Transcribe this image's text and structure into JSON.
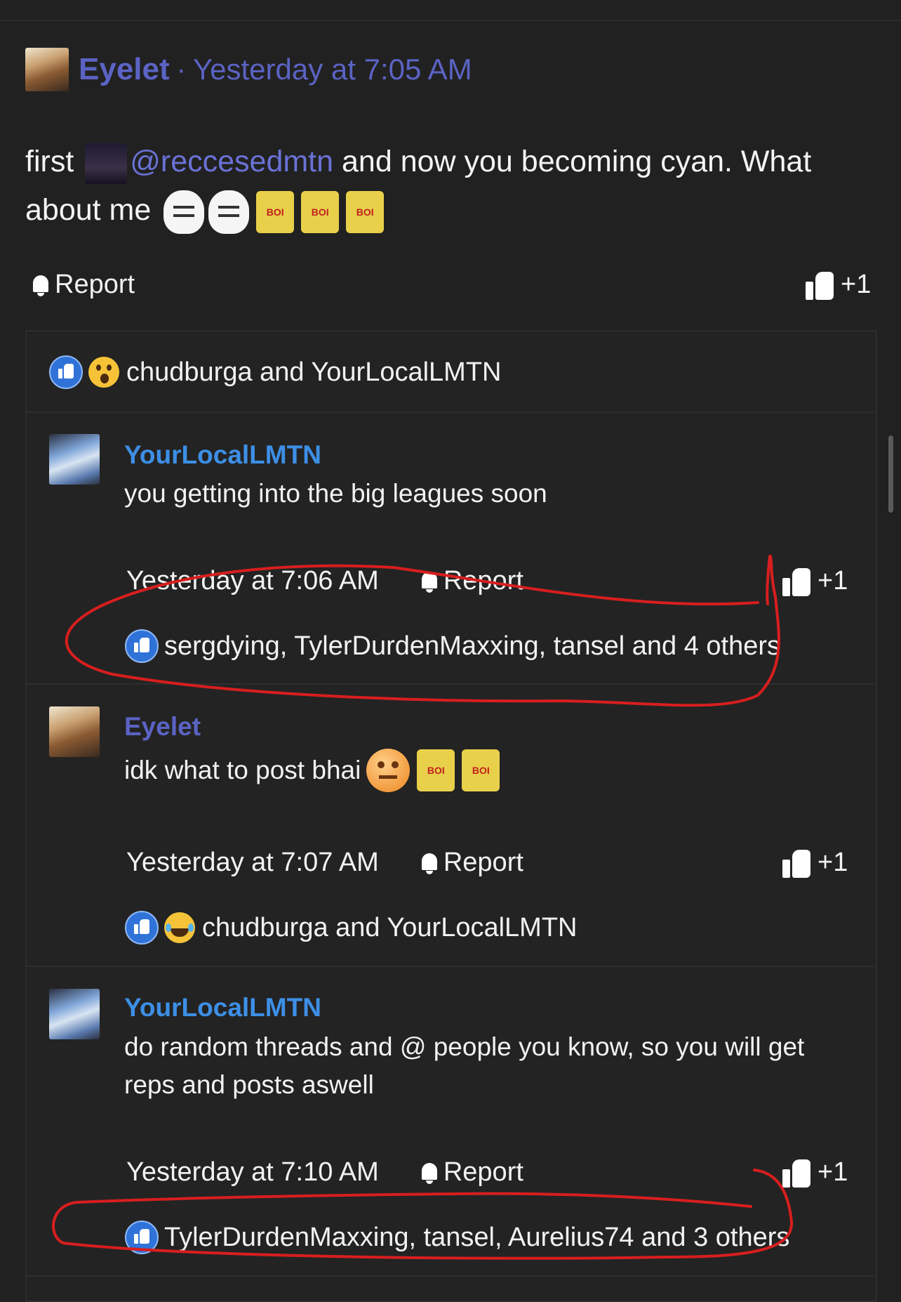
{
  "post": {
    "author": "Eyelet",
    "separator": "·",
    "time": "Yesterday at 7:05 AM",
    "text_start": "first",
    "mention": "@reccesedmtn",
    "text_end": "and now you becoming cyan. What about me",
    "emojis": [
      "wojak-emoji",
      "wojak-emoji",
      "spongebob-emoji",
      "spongebob-emoji",
      "spongebob-emoji"
    ],
    "sponge_text": "BOI",
    "report_label": "Report",
    "plus_one_label": "+1",
    "reactions_text": "chudburga and YourLocalLMTN"
  },
  "replies": [
    {
      "author": "YourLocalLMTN",
      "text": "you getting into the big leagues soon",
      "time": "Yesterday at 7:06 AM",
      "report_label": "Report",
      "plus_one_label": "+1",
      "reactions_text": "sergdying, TylerDurdenMaxxing, tansel and 4 others"
    },
    {
      "author": "Eyelet",
      "text": "idk what to post bhai",
      "time": "Yesterday at 7:07 AM",
      "report_label": "Report",
      "plus_one_label": "+1",
      "reactions_text": "chudburga and YourLocalLMTN"
    },
    {
      "author": "YourLocalLMTN",
      "text": "do random threads and @ people you know, so you will get reps and posts aswell",
      "time": "Yesterday at 7:10 AM",
      "report_label": "Report",
      "plus_one_label": "+1",
      "reactions_text": "TylerDurdenMaxxing, tansel, Aurelius74 and 3 others"
    }
  ],
  "colors": {
    "background": "#212121",
    "author_purple": "#5b63c4",
    "author_blue": "#3d8fe6",
    "annotation_red": "#d81e1e"
  }
}
